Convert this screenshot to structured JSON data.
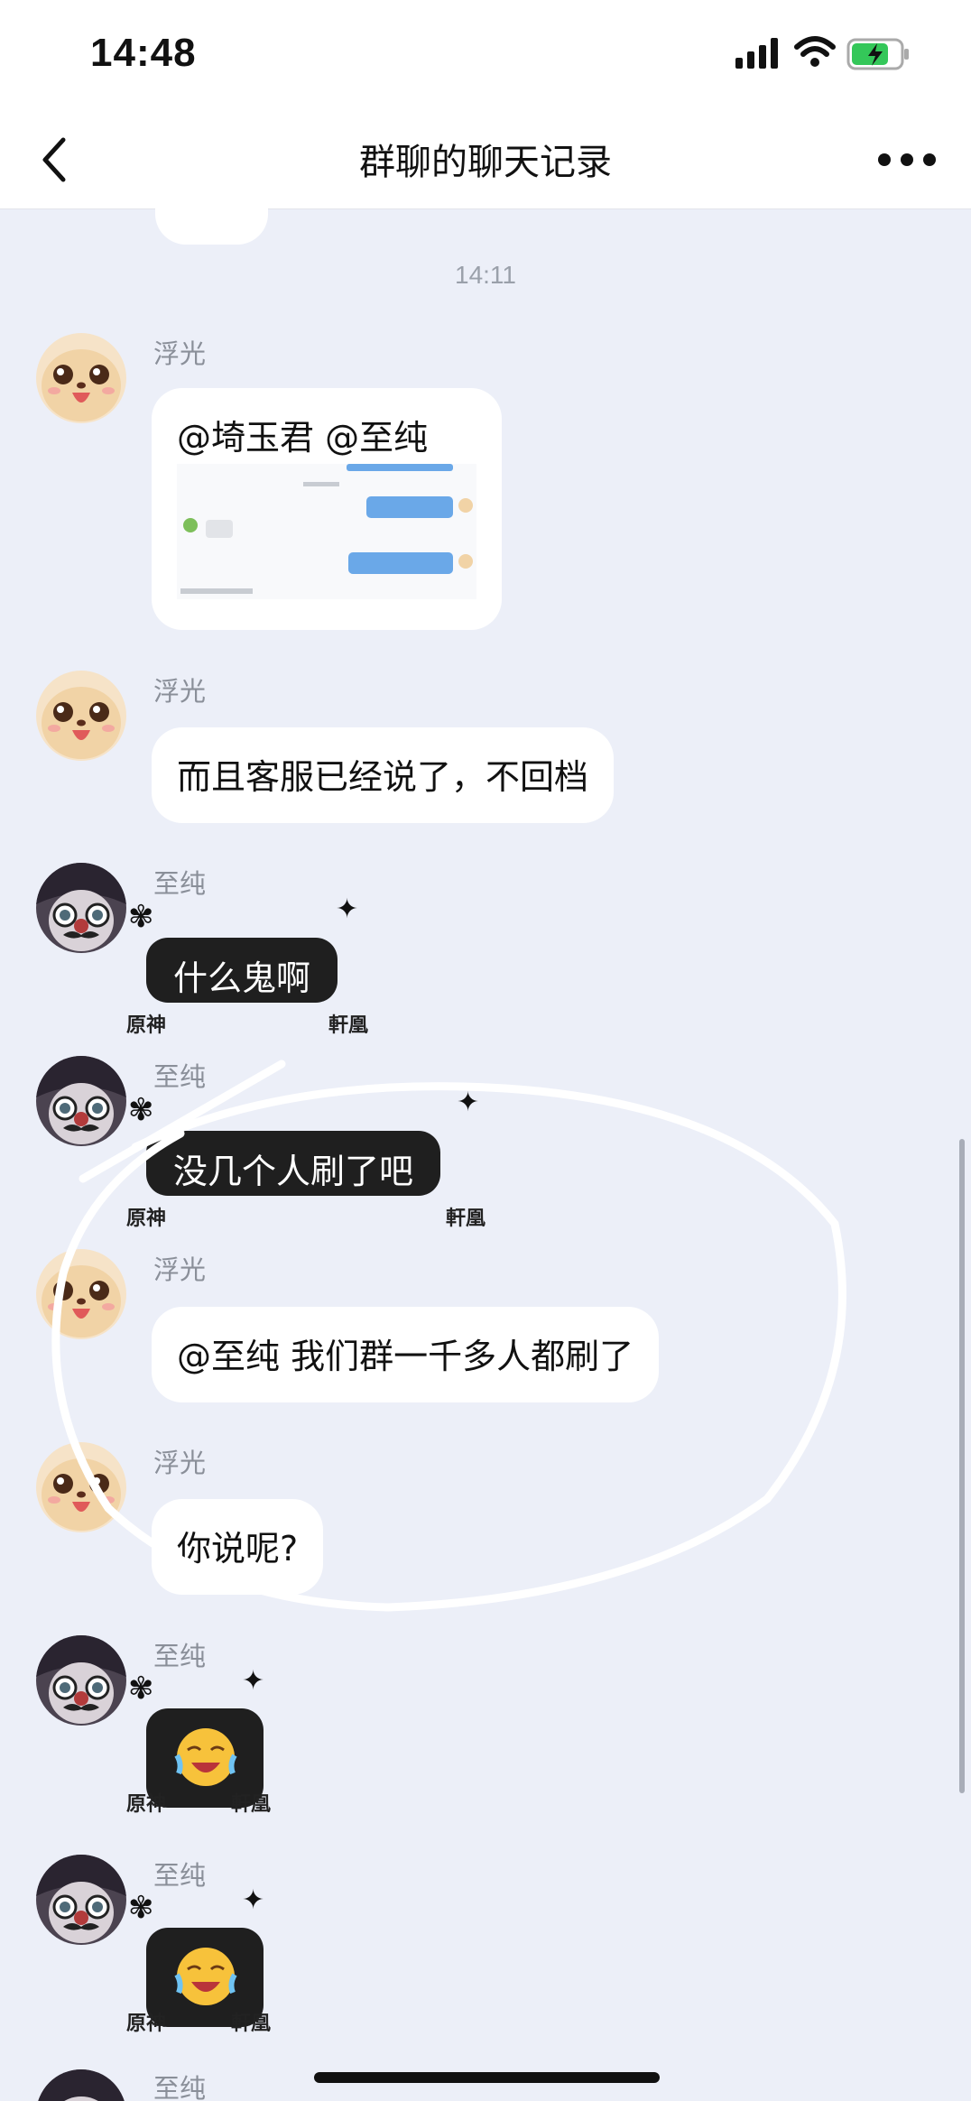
{
  "status_bar": {
    "time": "14:48"
  },
  "nav": {
    "title": "群聊的聊天记录",
    "back_icon": "chevron-left-icon",
    "more_icon": "ellipsis-icon"
  },
  "chat": {
    "timestamp": "14:11",
    "messages": [
      {
        "sender": "浮光",
        "text": "@埼玉君 @至纯",
        "attachment": "screenshot-image"
      },
      {
        "sender": "浮光",
        "text": "而且客服已经说了，不回档"
      },
      {
        "sender": "至纯",
        "text": "什么鬼啊"
      },
      {
        "sender": "至纯",
        "text": "没几个人刷了吧"
      },
      {
        "sender": "浮光",
        "text": "@至纯 我们群一千多人都刷了"
      },
      {
        "sender": "浮光",
        "text": "你说呢?"
      },
      {
        "sender": "至纯",
        "emoji": "crying-laughing-emoji"
      },
      {
        "sender": "至纯",
        "emoji": "crying-laughing-emoji"
      },
      {
        "sender": "至纯"
      }
    ]
  },
  "bubble_frame_text": {
    "left": "原神",
    "right": "軒凰"
  },
  "colors": {
    "background": "#eceff8",
    "dark_bubble": "#1f1f1f",
    "battery": "#34c759"
  }
}
